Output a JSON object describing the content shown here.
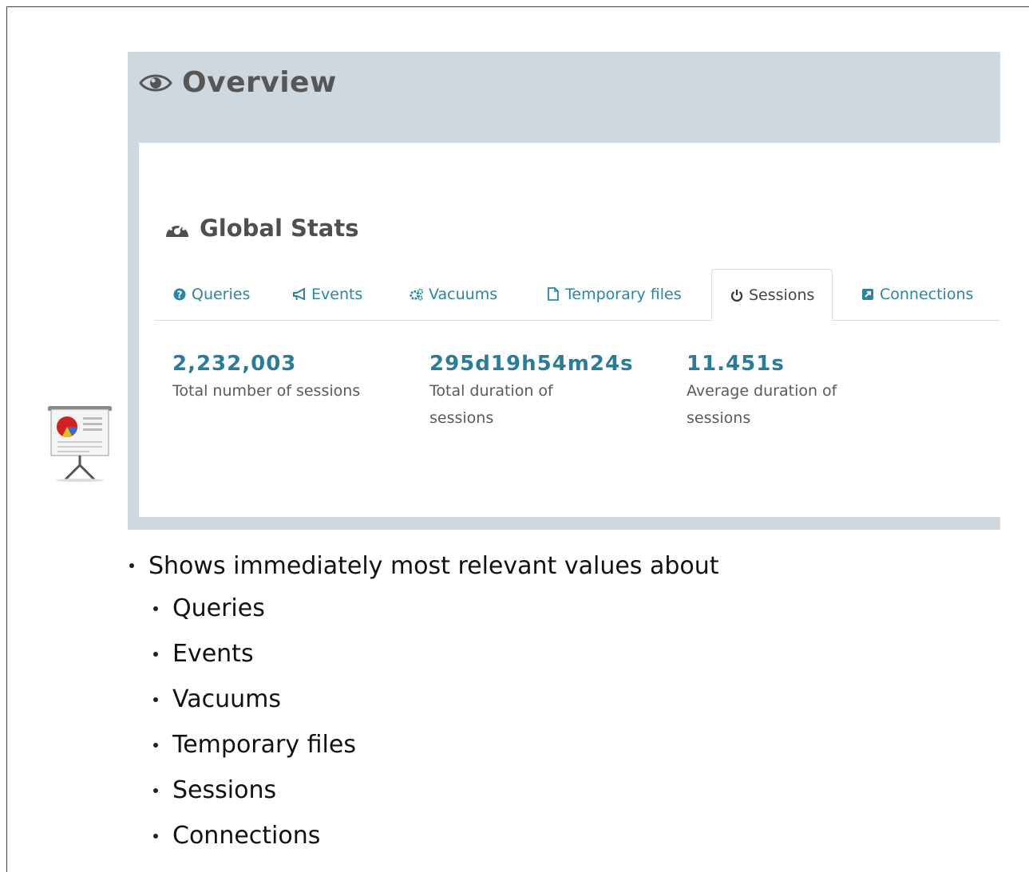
{
  "overview": {
    "title": "Overview",
    "icon": "eye-icon"
  },
  "global_stats": {
    "title": "Global Stats",
    "icon": "dashboard-gauge-icon"
  },
  "tabs": [
    {
      "label": "Queries",
      "icon": "question-circle-icon",
      "active": false
    },
    {
      "label": "Events",
      "icon": "bullhorn-icon",
      "active": false
    },
    {
      "label": "Vacuums",
      "icon": "gears-icon",
      "active": false
    },
    {
      "label": "Temporary files",
      "icon": "file-icon",
      "active": false
    },
    {
      "label": "Sessions",
      "icon": "power-icon",
      "active": true
    },
    {
      "label": "Connections",
      "icon": "external-link-icon",
      "active": false
    }
  ],
  "stats": [
    {
      "value": "2,232,003",
      "label": "Total number of sessions"
    },
    {
      "value": "295d19h54m24s",
      "label": "Total duration of sessions"
    },
    {
      "value": "11.451s",
      "label": "Average duration of sessions"
    }
  ],
  "bullets": {
    "main": "Shows immediately most relevant values about",
    "items": [
      "Queries",
      "Events",
      "Vacuums",
      "Temporary files",
      "Sessions",
      "Connections"
    ]
  },
  "colors": {
    "accent": "#2a86a8",
    "stat_value": "#2a7d99",
    "header_bg": "#ced8de"
  }
}
